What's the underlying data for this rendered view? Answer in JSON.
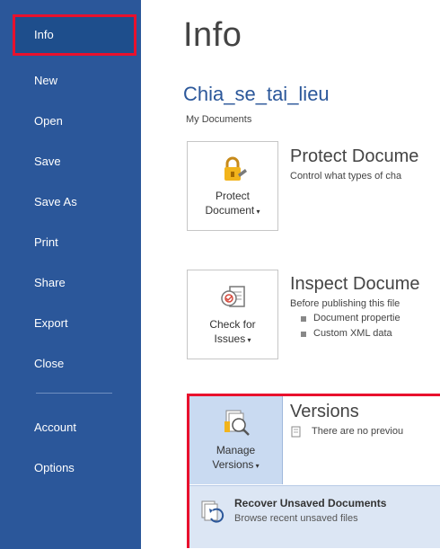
{
  "sidebar": {
    "items": [
      {
        "label": "Info"
      },
      {
        "label": "New"
      },
      {
        "label": "Open"
      },
      {
        "label": "Save"
      },
      {
        "label": "Save As"
      },
      {
        "label": "Print"
      },
      {
        "label": "Share"
      },
      {
        "label": "Export"
      },
      {
        "label": "Close"
      },
      {
        "label": "Account"
      },
      {
        "label": "Options"
      }
    ]
  },
  "main": {
    "title": "Info",
    "doc_name": "Chia_se_tai_lieu",
    "doc_location": "My Documents",
    "protect": {
      "button_label_1": "Protect",
      "button_label_2": "Document",
      "heading": "Protect Docume",
      "desc": "Control what types of cha"
    },
    "inspect": {
      "button_label_1": "Check for",
      "button_label_2": "Issues",
      "heading": "Inspect Docume",
      "desc": "Before publishing this file",
      "bullets": [
        "Document propertie",
        "Custom XML data"
      ]
    },
    "versions": {
      "button_label_1": "Manage",
      "button_label_2": "Versions",
      "heading": "Versions",
      "desc": "There are no previou",
      "recover_title": "Recover Unsaved Documents",
      "recover_sub": "Browse recent unsaved files"
    }
  },
  "colors": {
    "sidebar_bg": "#2b579a",
    "highlight": "#e8112d",
    "doc_name": "#2b579a"
  }
}
